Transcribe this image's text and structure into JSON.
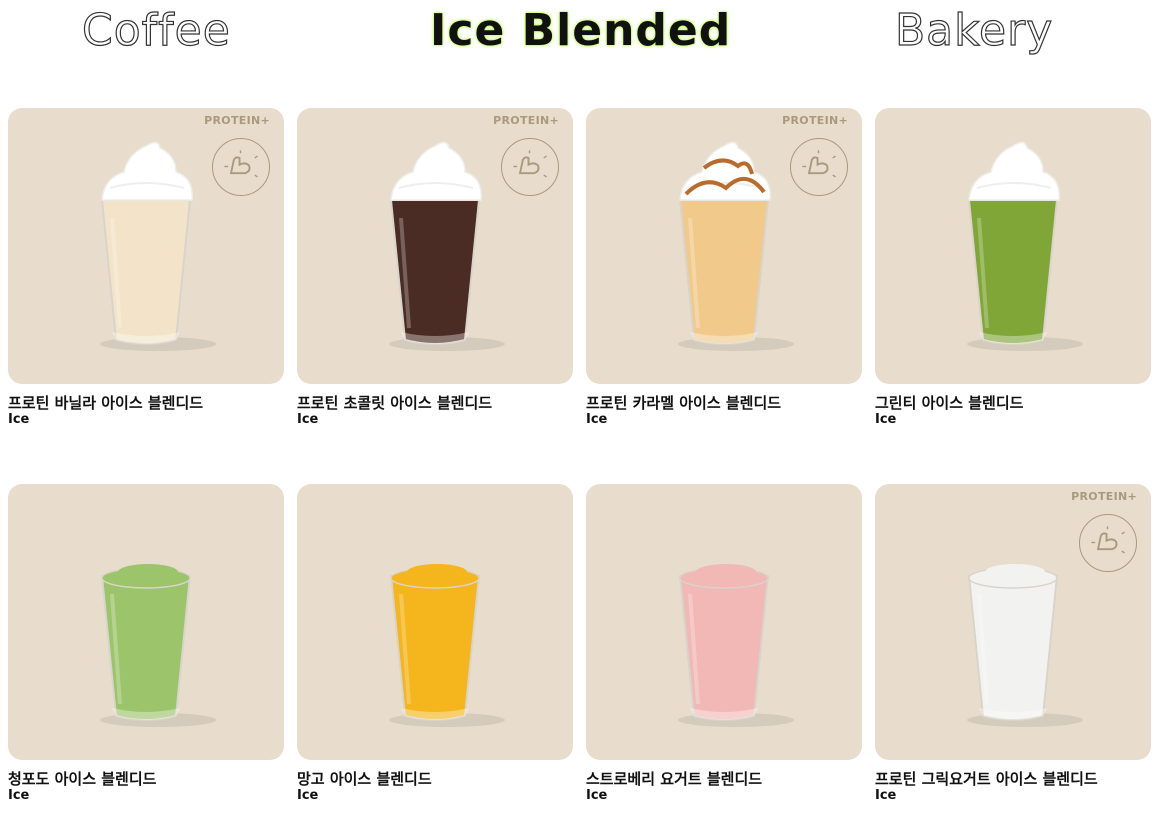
{
  "tabs": [
    {
      "label": "Coffee",
      "active": false
    },
    {
      "label": "Ice Blended",
      "active": true
    },
    {
      "label": "Bakery",
      "active": false
    }
  ],
  "products": [
    {
      "name": "프로틴 바닐라 아이스 블렌디드",
      "temp": "Ice",
      "badge": "PROTEIN+",
      "color": "#f3e3c8",
      "topping": "whip"
    },
    {
      "name": "프로틴 초콜릿 아이스 블렌디드",
      "temp": "Ice",
      "badge": "PROTEIN+",
      "color": "#4a2c24",
      "topping": "whip"
    },
    {
      "name": "프로틴 카라멜 아이스 블렌디드",
      "temp": "Ice",
      "badge": "PROTEIN+",
      "color": "#f1c98a",
      "topping": "caramel"
    },
    {
      "name": "그린티 아이스 블렌디드",
      "temp": "Ice",
      "badge": "",
      "color": "#7fa636",
      "topping": "whip"
    },
    {
      "name": "청포도 아이스 블렌디드",
      "temp": "Ice",
      "badge": "",
      "color": "#9cc46a",
      "topping": "none"
    },
    {
      "name": "망고 아이스 블렌디드",
      "temp": "Ice",
      "badge": "",
      "color": "#f5b51c",
      "topping": "none"
    },
    {
      "name": "스트로베리 요거트 블렌디드",
      "temp": "Ice",
      "badge": "",
      "color": "#f1b8b6",
      "topping": "none"
    },
    {
      "name": "프로틴 그릭요거트 아이스 블렌디드",
      "temp": "Ice",
      "badge": "PROTEIN+",
      "color": "#f2f3f0",
      "topping": "none"
    }
  ]
}
